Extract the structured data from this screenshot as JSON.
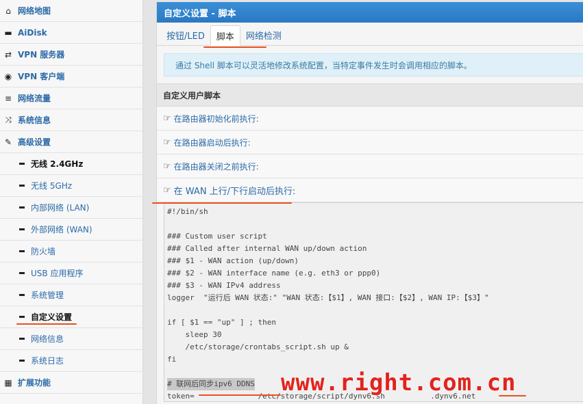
{
  "sidebar": {
    "items": [
      {
        "icon": "home-icon",
        "glyph": "⌂",
        "label": "网络地图"
      },
      {
        "icon": "drive-icon",
        "glyph": "▬",
        "label": "AiDisk"
      },
      {
        "icon": "retweet-icon",
        "glyph": "⇄",
        "label": "VPN 服务器"
      },
      {
        "icon": "globe-icon",
        "glyph": "◉",
        "label": "VPN 客户端"
      },
      {
        "icon": "list-icon",
        "glyph": "≡",
        "label": "网络流量"
      },
      {
        "icon": "shuffle-icon",
        "glyph": "⤨",
        "label": "系统信息"
      },
      {
        "icon": "wrench-icon",
        "glyph": "✎",
        "label": "高级设置"
      }
    ],
    "subitems": [
      {
        "label": "无线 2.4GHz"
      },
      {
        "label": "无线 5GHz"
      },
      {
        "label": "内部网络 (LAN)"
      },
      {
        "label": "外部网络 (WAN)"
      },
      {
        "label": "防火墙"
      },
      {
        "label": "USB 应用程序"
      },
      {
        "label": "系统管理"
      },
      {
        "label": "自定义设置"
      },
      {
        "label": "网络信息"
      },
      {
        "label": "系统日志"
      }
    ],
    "extra": {
      "icon": "grid-icon",
      "glyph": "▦",
      "label": "扩展功能"
    }
  },
  "main": {
    "title": "自定义设置 - 脚本",
    "tabs": [
      "按钮/LED",
      "脚本",
      "网络检测"
    ],
    "info": "通过 Shell 脚本可以灵活地修改系统配置，当特定事件发生时会调用相应的脚本。",
    "section": "自定义用户脚本",
    "scripts": [
      "在路由器初始化前执行:",
      "在路由器启动后执行:",
      "在路由器关闭之前执行:",
      "在 WAN 上行/下行启动后执行:"
    ],
    "code": [
      "#!/bin/sh",
      "",
      "### Custom user script",
      "### Called after internal WAN up/down action",
      "### $1 - WAN action (up/down)",
      "### $2 - WAN interface name (e.g. eth3 or ppp0)",
      "### $3 - WAN IPv4 address",
      "logger  \"运行后 WAN 状态:\" \"WAN 状态:【$1】, WAN 接口:【$2】, WAN IP:【$3】\"",
      "",
      "if [ $1 == \"up\" ] ; then",
      "    sleep 30",
      "    /etc/storage/crontabs_script.sh up &",
      "fi",
      "",
      "# 联网后同步ipv6 DDNS",
      "token=              /etc/storage/script/dynv6.sh          .dynv6.net"
    ]
  },
  "watermark": "www.right.com.cn",
  "colors": {
    "header": "#2a78c4",
    "link": "#2b6aa8",
    "annotation": "#e8501d",
    "watermark": "#e3231d"
  }
}
